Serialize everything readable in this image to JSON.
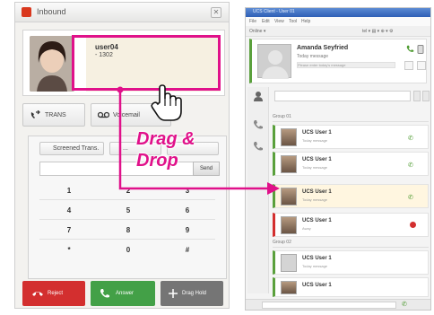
{
  "inbound": {
    "title": "Inbound",
    "close": "✕",
    "caller_name": "user04",
    "caller_number": "- 1302",
    "transfer_label": "TRANS",
    "voicemail_label": "Voicemail",
    "tabs": [
      "Screened Trans.",
      "...",
      ""
    ],
    "dial_label": "Send",
    "keys": [
      "1",
      "2",
      "3",
      "4",
      "5",
      "6",
      "7",
      "8",
      "9",
      "*",
      "0",
      "#"
    ],
    "buttons": [
      "Reject",
      "Answer",
      "Drag Hold"
    ]
  },
  "ucs": {
    "title": "UCS Client - User 01",
    "menu": [
      "File",
      "Edit",
      "View",
      "Tool",
      "Help"
    ],
    "status_left": "Online ▾",
    "status_right": "tel ▾   ▤ ▾   ⊕ ▾  ⚙",
    "profile_name": "Amanda Seyfried",
    "profile_status": "Today message",
    "profile_msg": "Please enter today's message",
    "groups": [
      "Group 01",
      "Group 02"
    ],
    "contacts": [
      {
        "name": "UCS User 1",
        "msg": "Today message"
      },
      {
        "name": "UCS User 1",
        "msg": "Today message"
      },
      {
        "name": "UCS User 1",
        "msg": "Today message"
      },
      {
        "name": "UCS User 1",
        "msg": "Away"
      },
      {
        "name": "UCS User 1",
        "msg": "Today message"
      },
      {
        "name": "UCS User 1",
        "msg": ""
      }
    ]
  },
  "annotation": {
    "line1": "Drag &",
    "line2": "Drop"
  },
  "colors": {
    "accent": "#e0118a",
    "reject": "#d32f2f",
    "answer": "#43a047",
    "hold": "#757575",
    "online": "#5aa03c"
  }
}
